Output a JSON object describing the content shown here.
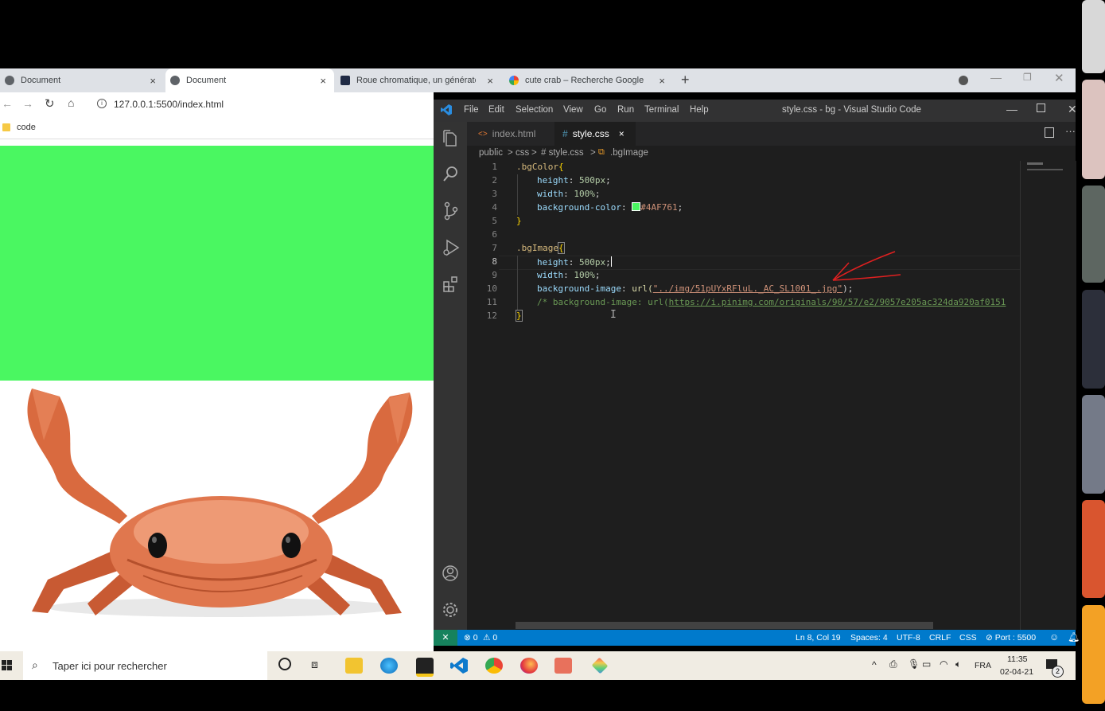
{
  "browser": {
    "tabs": [
      {
        "label": "Document",
        "close": "×"
      },
      {
        "label": "Document",
        "close": "×"
      },
      {
        "label": "Roue chromatique, un générateu",
        "close": "×"
      },
      {
        "label": "cute crab – Recherche Google",
        "close": "×"
      }
    ],
    "new_tab": "+",
    "url": "127.0.0.1:5500/index.html",
    "bookmark": "code",
    "page_bg_color": "#4AF761"
  },
  "vscode": {
    "menu": [
      "File",
      "Edit",
      "Selection",
      "View",
      "Go",
      "Run",
      "Terminal",
      "Help"
    ],
    "title": "style.css - bg - Visual Studio Code",
    "tabs": [
      {
        "label": "index.html"
      },
      {
        "label": "style.css",
        "close": "×"
      }
    ],
    "breadcrumb": {
      "p1": "public",
      "p2": "css",
      "p3": "# style.css",
      "p4": ".bgImage",
      "sep": ">"
    },
    "lines": [
      {
        "n": "1"
      },
      {
        "n": "2"
      },
      {
        "n": "3"
      },
      {
        "n": "4"
      },
      {
        "n": "5"
      },
      {
        "n": "6"
      },
      {
        "n": "7"
      },
      {
        "n": "8"
      },
      {
        "n": "9"
      },
      {
        "n": "10"
      },
      {
        "n": "11"
      },
      {
        "n": "12"
      }
    ],
    "code": {
      "l1_sel": ".bgColor",
      "l1_brace": "{",
      "l2_prop": "height",
      "l2_val": "500px",
      "l3_prop": "width",
      "l3_val": "100%",
      "l4_prop": "background-color",
      "l4_val": "#4AF761",
      "l5": "}",
      "l7_sel": ".bgImage",
      "l7_brace": "{",
      "l8_prop": "height",
      "l8_val": "500px",
      "l9_prop": "width",
      "l9_val": "100%",
      "l10_prop": "background-image",
      "l10_fn": "url(",
      "l10_str": "\"../img/51pUYxRFluL._AC_SL1001_.jpg\"",
      "l10_end": ");",
      "l11_comment": "/* background-image: url(",
      "l11_link": "https://i.pinimg.com/originals/90/57/e2/9057e205ac324da920af0151",
      "l12": "}"
    },
    "status": {
      "errors": "⊗ 0",
      "warnings": "⚠ 0",
      "position": "Ln 8, Col 19",
      "spaces": "Spaces: 4",
      "encoding": "UTF-8",
      "eol": "CRLF",
      "language": "CSS",
      "port": "⊘ Port : 5500"
    }
  },
  "taskbar": {
    "search_placeholder": "Taper ici pour rechercher",
    "lang": "FRA",
    "time": "11:35",
    "date": "02-04-21",
    "notif_count": "2"
  }
}
